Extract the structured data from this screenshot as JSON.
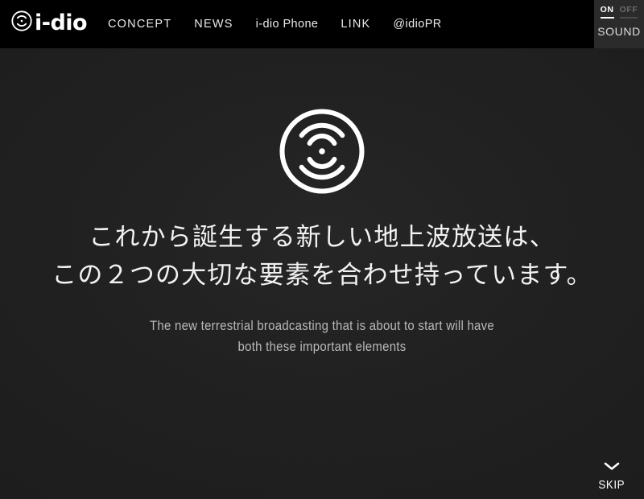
{
  "header": {
    "logo": {
      "icon": "i-dio-wave-mark-icon",
      "wordmark": "i-dio"
    },
    "nav": [
      {
        "label": "CONCEPT",
        "style": "caps"
      },
      {
        "label": "NEWS",
        "style": "caps"
      },
      {
        "label": "i-dio Phone",
        "style": "mixed"
      },
      {
        "label": "LINK",
        "style": "caps"
      },
      {
        "label": "@idioPR",
        "style": "mixed"
      }
    ],
    "sound": {
      "label": "SOUND",
      "on_label": "ON",
      "off_label": "OFF",
      "selected": "ON"
    }
  },
  "main": {
    "hero_icon": "i-dio-broadcast-wave-mark-icon",
    "headline_lines": [
      "これから誕生する新しい地上波放送は、",
      "この２つの大切な要素を合わせ持っています。"
    ],
    "subtitle_lines": [
      "The new terrestrial broadcasting that is about to start will have",
      "both these important elements"
    ]
  },
  "footer": {
    "skip": {
      "label": "SKIP",
      "icon": "chevron-down-icon"
    }
  },
  "colors": {
    "header_background": "#000000",
    "page_background": "#1f1f1f",
    "sound_panel_background": "#2b2b2b",
    "primary_text": "#ffffff",
    "headline_text": "#f2f2f2",
    "subtitle_text": "#b9b9b9",
    "inactive_text": "#6b6b6b"
  }
}
